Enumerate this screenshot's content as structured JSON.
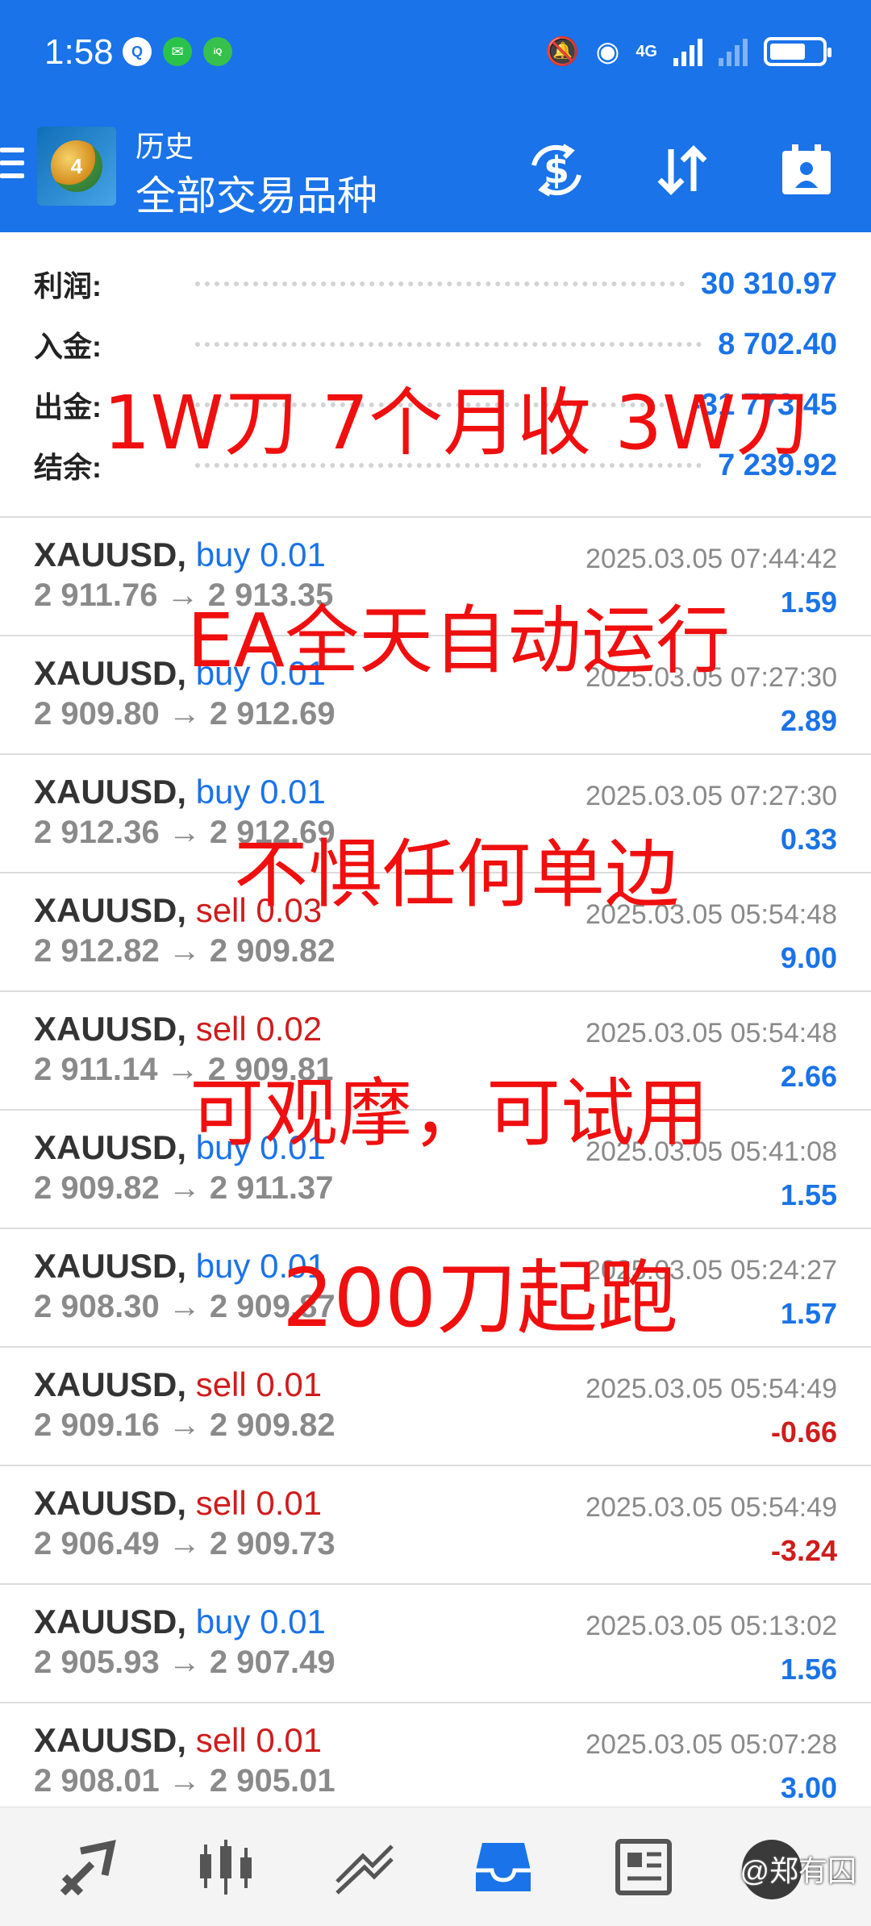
{
  "status_bar": {
    "time": "1:58",
    "network_label": "4G",
    "battery_level": 0.7,
    "notification_icons": [
      "qq-icon",
      "wechat-icon",
      "iqiyi-icon"
    ]
  },
  "app_bar": {
    "subtitle": "历史",
    "title": "全部交易品种"
  },
  "summary": {
    "profit_label": "利润:",
    "profit_value": "30 310.97",
    "deposit_label": "入金:",
    "deposit_value": "8 702.40",
    "withdraw_label": "出金:",
    "withdraw_value": "-31 773.45",
    "balance_label": "结余:",
    "balance_value": "7 239.92"
  },
  "trades": [
    {
      "symbol": "XAUUSD,",
      "side": "buy 0.01",
      "type": "buy",
      "price": "2 911.76 → 2 913.35",
      "time": "2025.03.05 07:44:42",
      "profit": "1.59",
      "negative": false
    },
    {
      "symbol": "XAUUSD,",
      "side": "buy 0.01",
      "type": "buy",
      "price": "2 909.80 → 2 912.69",
      "time": "2025.03.05 07:27:30",
      "profit": "2.89",
      "negative": false
    },
    {
      "symbol": "XAUUSD,",
      "side": "buy 0.01",
      "type": "buy",
      "price": "2 912.36 → 2 912.69",
      "time": "2025.03.05 07:27:30",
      "profit": "0.33",
      "negative": false
    },
    {
      "symbol": "XAUUSD,",
      "side": "sell 0.03",
      "type": "sell",
      "price": "2 912.82 → 2 909.82",
      "time": "2025.03.05 05:54:48",
      "profit": "9.00",
      "negative": false
    },
    {
      "symbol": "XAUUSD,",
      "side": "sell 0.02",
      "type": "sell",
      "price": "2 911.14 → 2 909.81",
      "time": "2025.03.05 05:54:48",
      "profit": "2.66",
      "negative": false
    },
    {
      "symbol": "XAUUSD,",
      "side": "buy 0.01",
      "type": "buy",
      "price": "2 909.82 → 2 911.37",
      "time": "2025.03.05 05:41:08",
      "profit": "1.55",
      "negative": false
    },
    {
      "symbol": "XAUUSD,",
      "side": "buy 0.01",
      "type": "buy",
      "price": "2 908.30 → 2 909.87",
      "time": "2025.03.05 05:24:27",
      "profit": "1.57",
      "negative": false
    },
    {
      "symbol": "XAUUSD,",
      "side": "sell 0.01",
      "type": "sell",
      "price": "2 909.16 → 2 909.82",
      "time": "2025.03.05 05:54:49",
      "profit": "-0.66",
      "negative": true
    },
    {
      "symbol": "XAUUSD,",
      "side": "sell 0.01",
      "type": "sell",
      "price": "2 906.49 → 2 909.73",
      "time": "2025.03.05 05:54:49",
      "profit": "-3.24",
      "negative": true
    },
    {
      "symbol": "XAUUSD,",
      "side": "buy 0.01",
      "type": "buy",
      "price": "2 905.93 → 2 907.49",
      "time": "2025.03.05 05:13:02",
      "profit": "1.56",
      "negative": false
    },
    {
      "symbol": "XAUUSD,",
      "side": "sell 0.01",
      "type": "sell",
      "price": "2 908.01 → 2 905.01",
      "time": "2025.03.05 05:07:28",
      "profit": "3.00",
      "negative": false
    }
  ],
  "overlay": {
    "line1": "1W刀 7个月收 3W刀",
    "line2": "EA全天自动运行",
    "line3": "不惧任何单边",
    "line4": "可观摩，可试用",
    "line5": "200刀起跑"
  },
  "bottom_nav": {
    "items": [
      "quotes-icon",
      "chart-icon",
      "trade-icon",
      "history-icon",
      "news-icon",
      "messages-icon"
    ],
    "active": "history-icon",
    "watermark": "@郑有囚"
  },
  "colors": {
    "primary": "#1a73e8",
    "negative": "#d01c1c",
    "overlay": "#f00f0f"
  }
}
